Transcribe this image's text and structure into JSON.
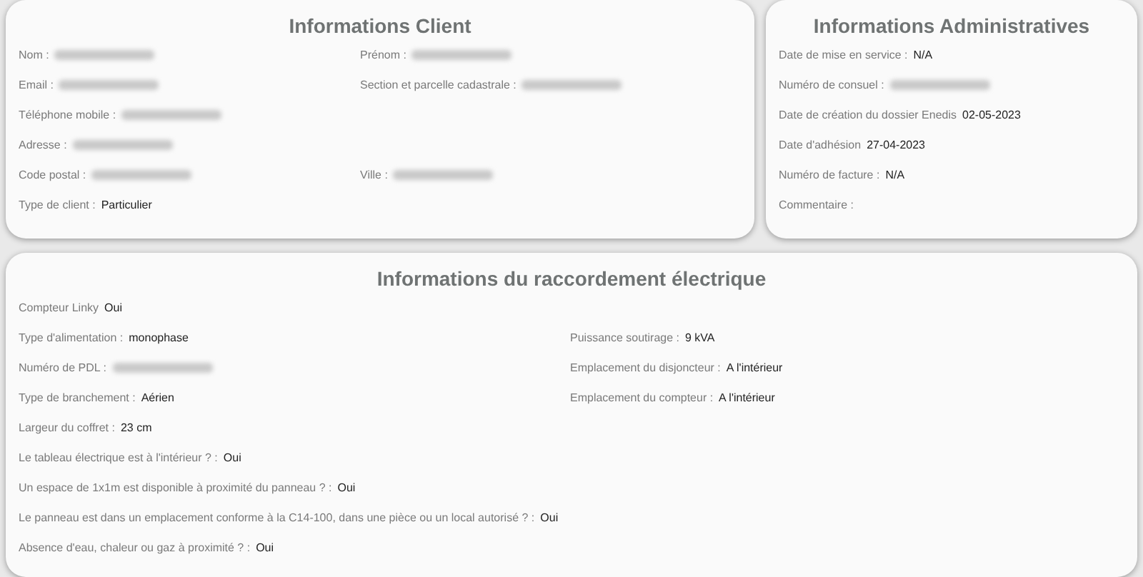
{
  "client": {
    "title": "Informations Client",
    "rows": [
      [
        {
          "label": "Nom :",
          "blurred": true
        },
        {
          "label": "Prénom :",
          "blurred": true
        }
      ],
      [
        {
          "label": "Email :",
          "blurred": true
        },
        {
          "label": "Section et parcelle cadastrale :",
          "blurred": true
        }
      ],
      [
        {
          "label": "Téléphone mobile :",
          "blurred": true
        }
      ],
      [
        {
          "label": "Adresse :",
          "blurred": true
        }
      ],
      [
        {
          "label": "Code postal :",
          "blurred": true
        },
        {
          "label": "Ville :",
          "blurred": true
        }
      ],
      [
        {
          "label": "Type de client :",
          "value": "Particulier",
          "blurred": false
        }
      ]
    ]
  },
  "admin": {
    "title": "Informations Administratives",
    "rows": [
      [
        {
          "label": "Date de mise en service :",
          "value": "N/A",
          "blurred": false
        }
      ],
      [
        {
          "label": "Numéro de consuel :",
          "blurred": true
        }
      ],
      [
        {
          "label": "Date de création du dossier Enedis",
          "value": "02-05-2023",
          "blurred": false
        }
      ],
      [
        {
          "label": "Date d'adhésion",
          "value": "27-04-2023",
          "blurred": false
        }
      ],
      [
        {
          "label": "Numéro de facture :",
          "value": "N/A",
          "blurred": false
        }
      ],
      [
        {
          "label": "Commentaire :",
          "blurred": false
        }
      ]
    ]
  },
  "connection": {
    "title": "Informations du raccordement électrique",
    "rows": [
      [
        {
          "label": "Compteur Linky",
          "value": "Oui",
          "blurred": false
        }
      ],
      [
        {
          "label": "Type d'alimentation :",
          "value": "monophase",
          "blurred": false
        },
        {
          "label": "Puissance soutirage :",
          "value": "9 kVA",
          "blurred": false
        }
      ],
      [
        {
          "label": "Numéro de PDL :",
          "blurred": true
        },
        {
          "label": "Emplacement du disjoncteur :",
          "value": "A l'intérieur",
          "blurred": false
        }
      ],
      [
        {
          "label": "Type de branchement :",
          "value": "Aérien",
          "blurred": false
        },
        {
          "label": "Emplacement du compteur :",
          "value": "A l'intérieur",
          "blurred": false
        }
      ],
      [
        {
          "label": "Largeur du coffret :",
          "value": "23 cm",
          "blurred": false
        }
      ],
      [
        {
          "label": "Le tableau électrique est à l'intérieur ? :",
          "value": "Oui",
          "blurred": false
        }
      ],
      [
        {
          "label": "Un espace de 1x1m est disponible à proximité du panneau ? :",
          "value": "Oui",
          "blurred": false
        }
      ],
      [
        {
          "label": "Le panneau est dans un emplacement conforme à la C14-100, dans une pièce ou un local autorisé ? :",
          "value": "Oui",
          "blurred": false
        }
      ],
      [
        {
          "label": "Absence d'eau, chaleur ou gaz à proximité ? :",
          "value": "Oui",
          "blurred": false
        }
      ]
    ]
  }
}
